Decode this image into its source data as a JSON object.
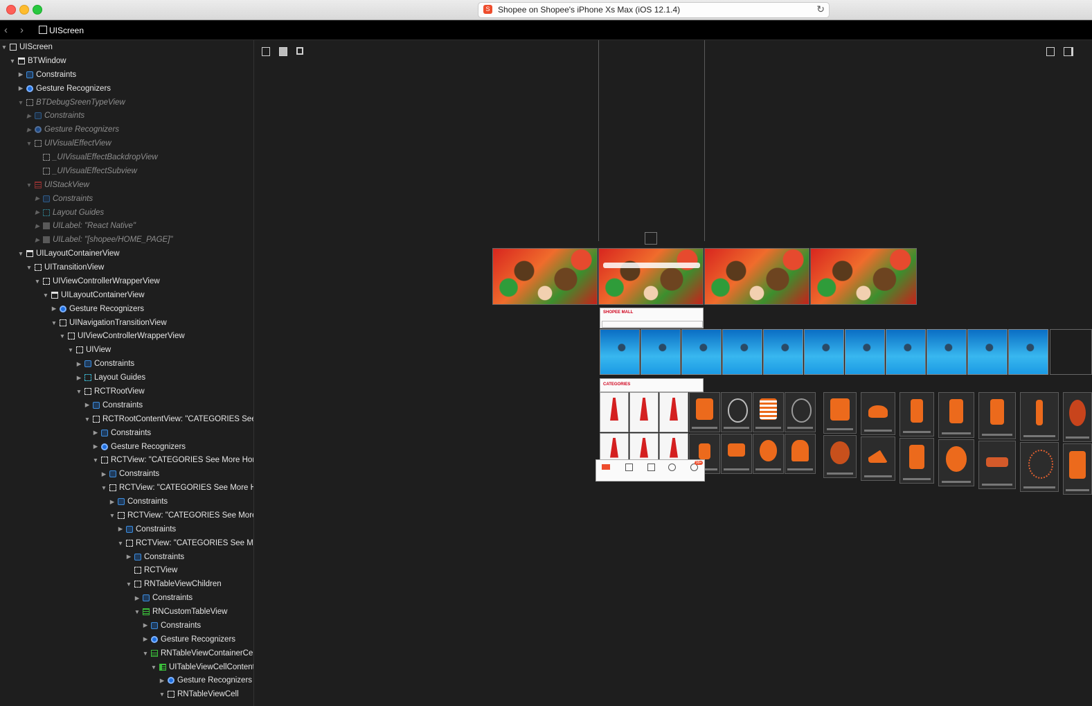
{
  "window": {
    "title": "Shopee on Shopee's iPhone Xs Max (iOS 12.1.4)",
    "app_icon_label": "S"
  },
  "navbar": {
    "back": "‹",
    "forward": "›",
    "breadcrumb": "UIScreen"
  },
  "tree": [
    {
      "label": "UIScreen",
      "icon": "screen",
      "depth": 0,
      "expanded": true,
      "has_children": true,
      "dimmed": false
    },
    {
      "label": "BTWindow",
      "icon": "window",
      "depth": 1,
      "expanded": true,
      "has_children": true,
      "dimmed": false
    },
    {
      "label": "Constraints",
      "icon": "constraints",
      "depth": 2,
      "expanded": false,
      "has_children": true,
      "dimmed": false
    },
    {
      "label": "Gesture Recognizers",
      "icon": "gesture",
      "depth": 2,
      "expanded": false,
      "has_children": true,
      "dimmed": false
    },
    {
      "label": "BTDebugSreenTypeView",
      "icon": "view",
      "depth": 2,
      "expanded": true,
      "has_children": true,
      "dimmed": true
    },
    {
      "label": "Constraints",
      "icon": "constraints",
      "depth": 3,
      "expanded": false,
      "has_children": true,
      "dimmed": true
    },
    {
      "label": "Gesture Recognizers",
      "icon": "gesture",
      "depth": 3,
      "expanded": false,
      "has_children": true,
      "dimmed": true
    },
    {
      "label": "UIVisualEffectView",
      "icon": "view",
      "depth": 3,
      "expanded": true,
      "has_children": true,
      "dimmed": true
    },
    {
      "label": "_UIVisualEffectBackdropView",
      "icon": "view",
      "depth": 4,
      "expanded": false,
      "has_children": false,
      "dimmed": true
    },
    {
      "label": "_UIVisualEffectSubview",
      "icon": "view",
      "depth": 4,
      "expanded": false,
      "has_children": false,
      "dimmed": true
    },
    {
      "label": "UIStackView",
      "icon": "stack",
      "depth": 3,
      "expanded": true,
      "has_children": true,
      "dimmed": true
    },
    {
      "label": "Constraints",
      "icon": "constraints",
      "depth": 4,
      "expanded": false,
      "has_children": true,
      "dimmed": true
    },
    {
      "label": "Layout Guides",
      "icon": "guides",
      "depth": 4,
      "expanded": false,
      "has_children": true,
      "dimmed": true
    },
    {
      "label": "UILabel: \"React Native\"",
      "icon": "label",
      "depth": 4,
      "expanded": false,
      "has_children": true,
      "dimmed": true
    },
    {
      "label": "UILabel: \"[shopee/HOME_PAGE]\"",
      "icon": "label",
      "depth": 4,
      "expanded": false,
      "has_children": true,
      "dimmed": true
    },
    {
      "label": "UILayoutContainerView",
      "icon": "window",
      "depth": 2,
      "expanded": true,
      "has_children": true,
      "dimmed": false
    },
    {
      "label": "UITransitionView",
      "icon": "view",
      "depth": 3,
      "expanded": true,
      "has_children": true,
      "dimmed": false
    },
    {
      "label": "UIViewControllerWrapperView",
      "icon": "view",
      "depth": 4,
      "expanded": true,
      "has_children": true,
      "dimmed": false
    },
    {
      "label": "UILayoutContainerView",
      "icon": "window",
      "depth": 5,
      "expanded": true,
      "has_children": true,
      "dimmed": false
    },
    {
      "label": "Gesture Recognizers",
      "icon": "gesture",
      "depth": 6,
      "expanded": false,
      "has_children": true,
      "dimmed": false
    },
    {
      "label": "UINavigationTransitionView",
      "icon": "view",
      "depth": 6,
      "expanded": true,
      "has_children": true,
      "dimmed": false
    },
    {
      "label": "UIViewControllerWrapperView",
      "icon": "view",
      "depth": 7,
      "expanded": true,
      "has_children": true,
      "dimmed": false
    },
    {
      "label": "UIView",
      "icon": "view",
      "depth": 8,
      "expanded": true,
      "has_children": true,
      "dimmed": false
    },
    {
      "label": "Constraints",
      "icon": "constraints",
      "depth": 9,
      "expanded": false,
      "has_children": true,
      "dimmed": false
    },
    {
      "label": "Layout Guides",
      "icon": "guides",
      "depth": 9,
      "expanded": false,
      "has_children": true,
      "dimmed": false
    },
    {
      "label": "RCTRootView",
      "icon": "view",
      "depth": 9,
      "expanded": true,
      "has_children": true,
      "dimmed": false
    },
    {
      "label": "Constraints",
      "icon": "constraints",
      "depth": 10,
      "expanded": false,
      "has_children": true,
      "dimmed": false
    },
    {
      "label": "RCTRootContentView: \"CATEGORIES See",
      "icon": "view",
      "depth": 10,
      "expanded": true,
      "has_children": true,
      "dimmed": false
    },
    {
      "label": "Constraints",
      "icon": "constraints",
      "depth": 11,
      "expanded": false,
      "has_children": true,
      "dimmed": false
    },
    {
      "label": "Gesture Recognizers",
      "icon": "gesture",
      "depth": 11,
      "expanded": false,
      "has_children": true,
      "dimmed": false
    },
    {
      "label": "RCTView: \"CATEGORIES See More Hom",
      "icon": "view",
      "depth": 11,
      "expanded": true,
      "has_children": true,
      "dimmed": false
    },
    {
      "label": "Constraints",
      "icon": "constraints",
      "depth": 12,
      "expanded": false,
      "has_children": true,
      "dimmed": false
    },
    {
      "label": "RCTView: \"CATEGORIES See More Ho",
      "icon": "view",
      "depth": 12,
      "expanded": true,
      "has_children": true,
      "dimmed": false
    },
    {
      "label": "Constraints",
      "icon": "constraints",
      "depth": 13,
      "expanded": false,
      "has_children": true,
      "dimmed": false
    },
    {
      "label": "RCTView: \"CATEGORIES See More",
      "icon": "view",
      "depth": 13,
      "expanded": true,
      "has_children": true,
      "dimmed": false
    },
    {
      "label": "Constraints",
      "icon": "constraints",
      "depth": 14,
      "expanded": false,
      "has_children": true,
      "dimmed": false
    },
    {
      "label": "RCTView: \"CATEGORIES See Mor",
      "icon": "view",
      "depth": 14,
      "expanded": true,
      "has_children": true,
      "dimmed": false
    },
    {
      "label": "Constraints",
      "icon": "constraints",
      "depth": 15,
      "expanded": false,
      "has_children": true,
      "dimmed": false
    },
    {
      "label": "RCTView",
      "icon": "view",
      "depth": 15,
      "expanded": false,
      "has_children": false,
      "dimmed": false
    },
    {
      "label": "RNTableViewChildren",
      "icon": "view",
      "depth": 15,
      "expanded": true,
      "has_children": true,
      "dimmed": false
    },
    {
      "label": "Constraints",
      "icon": "constraints",
      "depth": 16,
      "expanded": false,
      "has_children": true,
      "dimmed": false
    },
    {
      "label": "RNCustomTableView",
      "icon": "table",
      "depth": 16,
      "expanded": true,
      "has_children": true,
      "dimmed": false
    },
    {
      "label": "Constraints",
      "icon": "constraints",
      "depth": 17,
      "expanded": false,
      "has_children": true,
      "dimmed": false
    },
    {
      "label": "Gesture Recognizers",
      "icon": "gesture",
      "depth": 17,
      "expanded": false,
      "has_children": true,
      "dimmed": false
    },
    {
      "label": "RNTableViewContainerCel",
      "icon": "cell",
      "depth": 17,
      "expanded": true,
      "has_children": true,
      "dimmed": false
    },
    {
      "label": "UITableViewCellContent",
      "icon": "cellcontent",
      "depth": 18,
      "expanded": true,
      "has_children": true,
      "dimmed": false
    },
    {
      "label": "Gesture Recognizers",
      "icon": "gesture",
      "depth": 19,
      "expanded": false,
      "has_children": true,
      "dimmed": false
    },
    {
      "label": "RNTableViewCell",
      "icon": "view",
      "depth": 19,
      "expanded": true,
      "has_children": true,
      "dimmed": false
    }
  ],
  "canvas": {
    "mall_header": "SHOPEE MALL",
    "categories_header": "CATEGORIES",
    "tab_badge": "99+",
    "background": "#1e1e1e",
    "accent": "#ee4d2d"
  },
  "colors": {
    "selection": "#ee4d2d",
    "constraints": "#3d8dde",
    "gesture": "#1e6fe0",
    "stack": "#e04040",
    "table": "#3bbf3b"
  }
}
